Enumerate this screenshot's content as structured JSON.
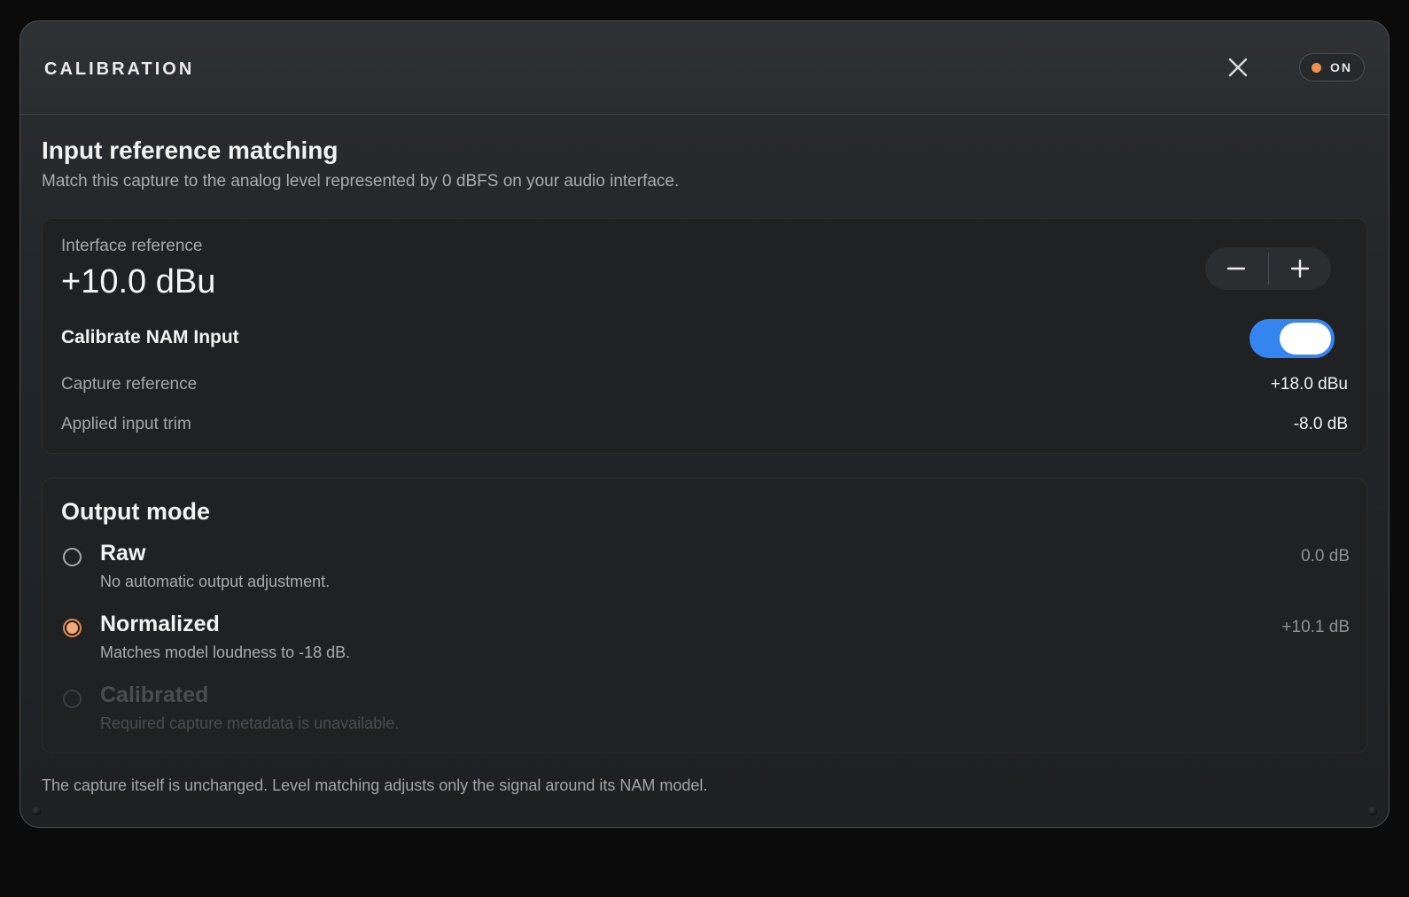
{
  "header": {
    "title": "CALIBRATION",
    "power_label": "ON",
    "power_dot_color": "#f0924f"
  },
  "input_reference": {
    "title": "Input reference matching",
    "subtitle": "Match this capture to the analog level represented by 0 dBFS on your audio interface.",
    "interface_reference_label": "Interface reference",
    "interface_reference_value": "+10.0 dBu",
    "decrement_label": "−",
    "increment_label": "+",
    "calibrate_label": "Calibrate NAM Input",
    "calibrate_enabled": true,
    "toggle_color": "#3485f0",
    "capture_reference_label": "Capture reference",
    "capture_reference_value": "+18.0 dBu",
    "applied_trim_label": "Applied input trim",
    "applied_trim_value": "-8.0 dB"
  },
  "output_mode": {
    "title": "Output mode",
    "selected": "Normalized",
    "accent_color": "#e88a4a",
    "options": [
      {
        "name": "Raw",
        "description": "No automatic output adjustment.",
        "value": "0.0 dB",
        "enabled": true
      },
      {
        "name": "Normalized",
        "description": "Matches model loudness to -18 dB.",
        "value": "+10.1 dB",
        "enabled": true
      },
      {
        "name": "Calibrated",
        "description": "Required capture metadata is unavailable.",
        "value": "",
        "enabled": false
      }
    ]
  },
  "footer": {
    "note": "The capture itself is unchanged. Level matching adjusts only the signal around its NAM model."
  }
}
